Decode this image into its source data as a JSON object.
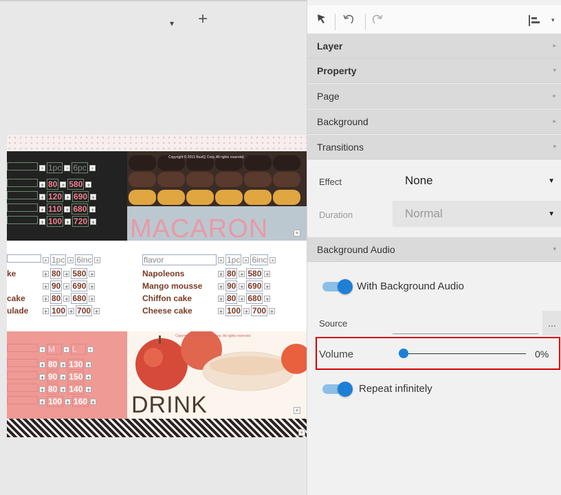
{
  "canvas": {
    "caret": "▾",
    "add": "+",
    "macaron_copyright": "Copyright © 2015 BestQ Corp. All rights reserved.",
    "macaron_title": "MACARON",
    "drink_copyright": "Copyright © 2015 BestQ Corp. All rights reserved.",
    "drink_title": "DRINK",
    "section1": {
      "header": [
        "1pc",
        "6pc"
      ],
      "rows": [
        {
          "p1": "80",
          "p2": "580"
        },
        {
          "p1": "120",
          "p2": "690"
        },
        {
          "p1": "110",
          "p2": "680"
        },
        {
          "p1": "100",
          "p2": "720"
        }
      ]
    },
    "section2": {
      "left_header": [
        "1pc",
        "6inc"
      ],
      "left_rows": [
        {
          "name": "ke",
          "p1": "80",
          "p2": "580"
        },
        {
          "name": "",
          "p1": "90",
          "p2": "690"
        },
        {
          "name": "cake",
          "p1": "80",
          "p2": "680"
        },
        {
          "name": "ulade",
          "p1": "100",
          "p2": "700"
        }
      ],
      "right_header": {
        "flavor": "flavor",
        "c1": "1pc",
        "c2": "6inc"
      },
      "right_rows": [
        {
          "name": "Napoleons",
          "p1": "80",
          "p2": "580"
        },
        {
          "name": "Mango mousse",
          "p1": "90",
          "p2": "690"
        },
        {
          "name": "Chiffon cake",
          "p1": "80",
          "p2": "680"
        },
        {
          "name": "Cheese cake",
          "p1": "100",
          "p2": "700"
        }
      ]
    },
    "section3": {
      "header": [
        "M",
        "L"
      ],
      "rows": [
        {
          "p1": "80",
          "p2": "130"
        },
        {
          "p1": "90",
          "p2": "150"
        },
        {
          "p1": "80",
          "p2": "140"
        },
        {
          "p1": "100",
          "p2": "160"
        }
      ]
    }
  },
  "panel": {
    "sections": {
      "layer": "Layer",
      "property": "Property",
      "page": "Page",
      "background": "Background",
      "transitions": "Transitions",
      "background_audio": "Background Audio"
    },
    "effect": {
      "label": "Effect",
      "value": "None"
    },
    "duration": {
      "label": "Duration",
      "value": "Normal"
    },
    "with_audio": {
      "label": "With Background Audio",
      "on": true
    },
    "source": {
      "label": "Source",
      "button": "..."
    },
    "volume": {
      "label": "Volume",
      "value_text": "0%",
      "value": 0
    },
    "repeat": {
      "label": "Repeat infinitely",
      "on": true
    }
  },
  "colors": {
    "accent": "#1e7fd6",
    "highlight": "#d40000"
  }
}
